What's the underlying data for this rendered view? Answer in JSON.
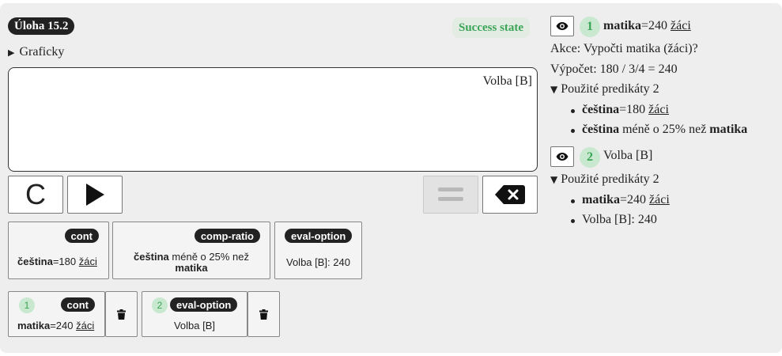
{
  "task": {
    "badge": "Úloha 15.2",
    "state": "Success state",
    "graf_label": "Graficky"
  },
  "editor": {
    "content": "Volba [B]"
  },
  "toolbar": {
    "clear_icon": "letter-c-icon",
    "run_icon": "play-icon",
    "equals_icon": "equals-icon",
    "backspace_icon": "backspace-icon"
  },
  "predicates": [
    {
      "tag": "cont",
      "entity": "čeština",
      "value": "=180",
      "unit": "žáci"
    },
    {
      "tag": "comp-ratio",
      "subject": "čeština",
      "relation": "méně o 25% než",
      "object": "matika"
    },
    {
      "tag": "eval-option",
      "text": "Volba [B]: 240"
    }
  ],
  "steps": [
    {
      "num": "1",
      "tag": "cont",
      "entity": "matika",
      "value": "=240",
      "unit": "žáci"
    },
    {
      "num": "2",
      "tag": "eval-option",
      "text": "Volba [B]"
    }
  ],
  "colors": {
    "success": "#3aa556",
    "badge_bg": "#222222",
    "card_bg": "#eeeeee"
  },
  "right": {
    "step1": {
      "num": "1",
      "entity": "matika",
      "value": "=240",
      "unit": "žáci",
      "akce": "Akce: Vypočti matika (žáci)?",
      "vypocet": "Výpočet: 180 / 3/4 = 240",
      "used_label": "Použité predikáty 2",
      "used": [
        {
          "entity": "čeština",
          "value": "=180",
          "unit": "žáci"
        },
        {
          "subject": "čeština",
          "relation": "méně o 25% než",
          "object": "matika"
        }
      ]
    },
    "step2": {
      "num": "2",
      "title": "Volba [B]",
      "used_label": "Použité predikáty 2",
      "used": [
        {
          "entity": "matika",
          "value": "=240",
          "unit": "žáci"
        },
        {
          "text": "Volba [B]: 240"
        }
      ]
    }
  }
}
